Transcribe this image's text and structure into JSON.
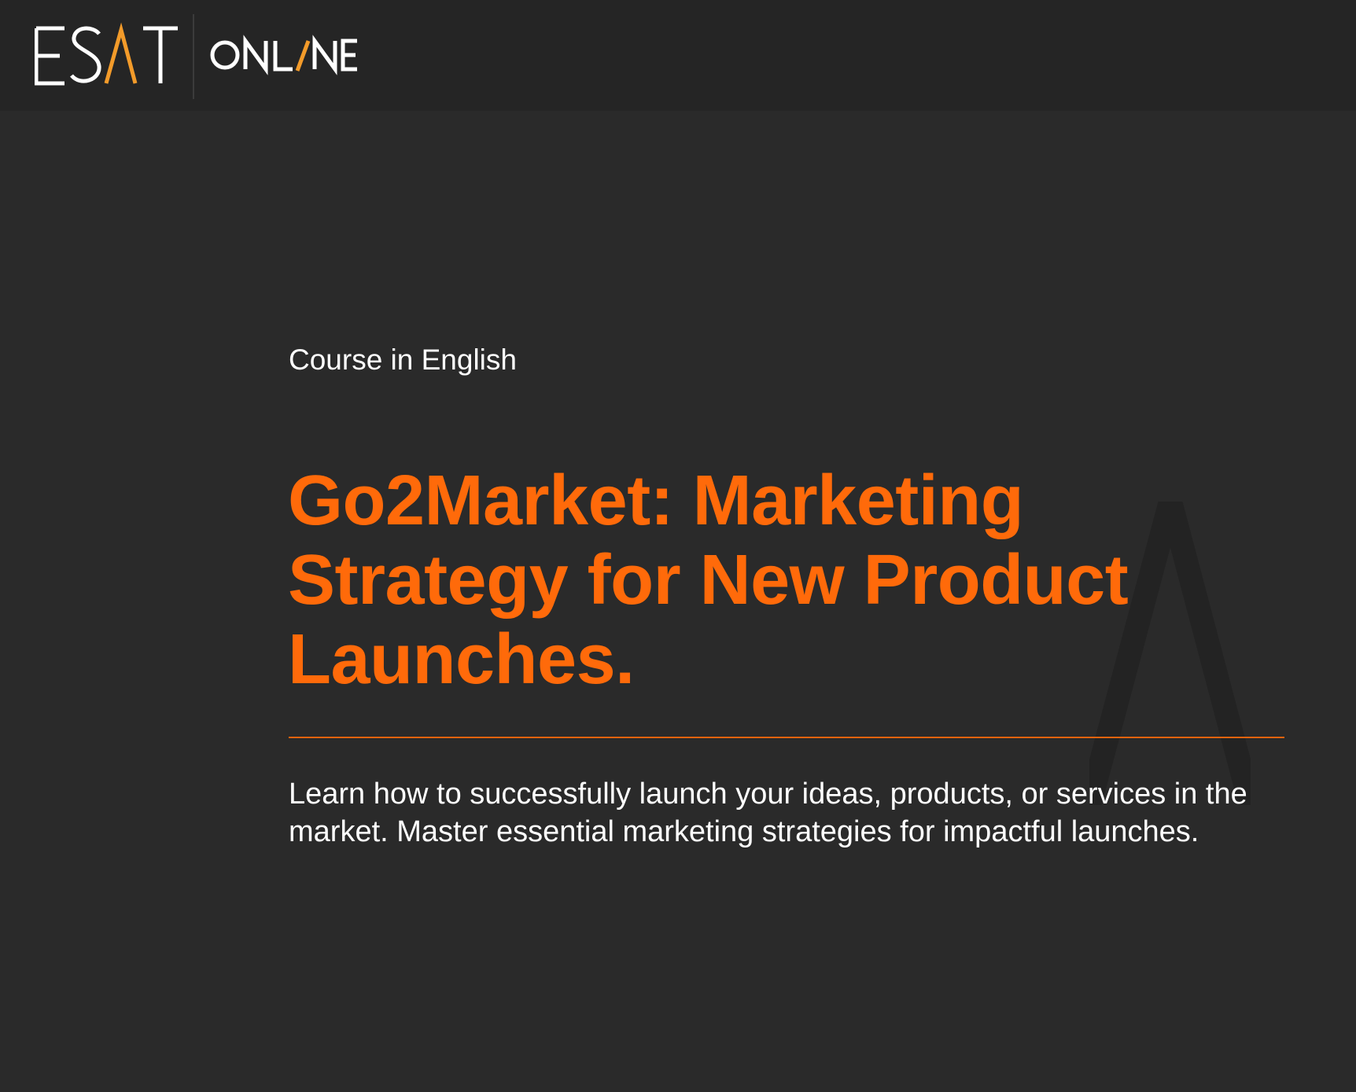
{
  "header": {
    "logo": {
      "brand_text": "ESAT",
      "sub_text": "ONLINE"
    }
  },
  "hero": {
    "eyebrow": "Course in English",
    "title_lines": [
      "Go2Market: Marketing",
      "Strategy for New Product",
      "Launches."
    ],
    "description": "Learn how to successfully launch your ideas, products, or services in the market. Master essential marketing strategies for impactful launches."
  },
  "colors": {
    "page_background": "#2a2a2a",
    "header_background": "#252525",
    "accent": "#ff6a0a",
    "text": "#ffffff"
  },
  "icons": {
    "background_mark": "triangle-mark-icon"
  }
}
